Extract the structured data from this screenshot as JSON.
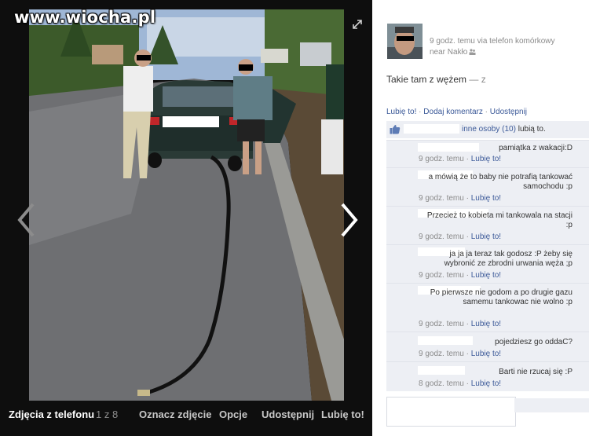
{
  "watermark": "www.wiocha.pl",
  "viewer": {
    "album_label": "Zdjęcia z telefonu",
    "counter": "1 z 8",
    "tag_label": "Oznacz zdjęcie",
    "options_label": "Opcje",
    "share_label": "Udostępnij",
    "like_label": "Lubię to!"
  },
  "post": {
    "meta_line1": "9 godz. temu via telefon komórkowy",
    "meta_line2": "near Nakło",
    "caption": "Takie tam z wężem",
    "caption_tail": "— z",
    "actions": {
      "like": "Lubię to!",
      "comment": "Dodaj komentarz",
      "share": "Udostępnij",
      "separator": "·"
    },
    "likes": {
      "link": "inne osoby (10)",
      "suffix": "lubią to."
    }
  },
  "comments": [
    {
      "text": "pamiątka z wakacji:D",
      "time": "9 godz. temu",
      "like": "Lubię to!"
    },
    {
      "text": "a mówią że to baby nie potrafią tankować samochodu :p",
      "time": "9 godz. temu",
      "like": "Lubię to!"
    },
    {
      "text": "Przecież to kobieta mi tankowala na stacji :p",
      "time": "9 godz. temu",
      "like": "Lubię to!"
    },
    {
      "text": "ja ja ja teraz tak godosz :P żeby się wybronić ze zbrodni urwania węża ;p",
      "time": "9 godz. temu",
      "like": "Lubię to!"
    },
    {
      "text": "Po pierwsze nie godom a po drugie gazu samemu tankowac nie wolno :p",
      "time": "9 godz. temu",
      "like": "Lubię to!"
    },
    {
      "text": "pojedziesz go oddaC?",
      "time": "9 godz. temu",
      "like": "Lubię to!"
    },
    {
      "text": "Barti nie rzucaj się :P",
      "time": "8 godz. temu",
      "like": "Lubię to!"
    }
  ],
  "colors": {
    "link": "#3b5998",
    "muted": "#8a8a8a",
    "comment_bg": "#edeff4",
    "viewer_bg": "#0e0e0e"
  }
}
